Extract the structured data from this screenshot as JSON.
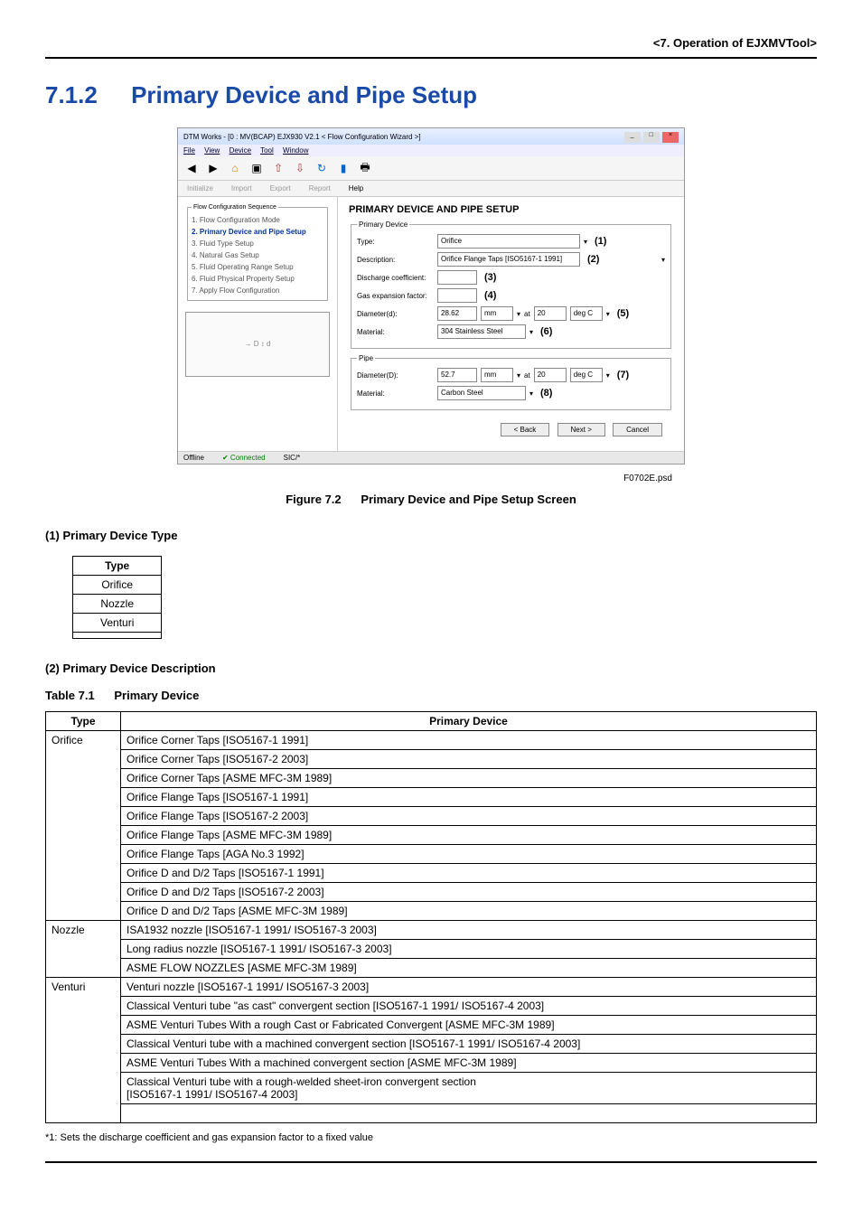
{
  "breadcrumb": "<7.  Operation of EJXMVTool>",
  "heading": {
    "num": "7.1.2",
    "title": "Primary Device and Pipe Setup"
  },
  "screenshot": {
    "titlebar": "DTM Works - [0 : MV(BCAP) EJX930 V2.1 < Flow Configuration Wizard >]",
    "menus": [
      "File",
      "View",
      "Device",
      "Tool",
      "Window"
    ],
    "subbar": [
      "Initialize",
      "Import",
      "Export",
      "Report",
      "Help"
    ],
    "main_title": "PRIMARY DEVICE AND PIPE SETUP",
    "sidebar_legend": "Flow Configuration Sequence",
    "steps": [
      "1. Flow Configuration Mode",
      "2. Primary Device and Pipe Setup",
      "3. Fluid Type Setup",
      "4. Natural Gas Setup",
      "5. Fluid Operating Range Setup",
      "6. Fluid Physical Property Setup",
      "7. Apply Flow Configuration"
    ],
    "primary_legend": "Primary Device",
    "pipe_legend": "Pipe",
    "fields": {
      "type_label": "Type:",
      "type_value": "Orifice",
      "desc_label": "Description:",
      "desc_value": "Orifice Flange Taps [ISO5167-1 1991]",
      "disc_label": "Discharge coefficient:",
      "gas_label": "Gas expansion factor:",
      "diam_d_label": "Diameter(d):",
      "diam_d_val": "28.62",
      "unit_mm": "mm",
      "at": "at",
      "ref_temp": "20",
      "degc": "deg C",
      "mat_label": "Material:",
      "mat1_value": "304 Stainless Steel",
      "diam_D_label": "Diameter(D):",
      "diam_D_val": "52.7",
      "mat2_value": "Carbon Steel"
    },
    "callouts": [
      "(1)",
      "(2)",
      "(3)",
      "(4)",
      "(5)",
      "(6)",
      "(7)",
      "(8)"
    ],
    "buttons": {
      "back": "< Back",
      "next": "Next >",
      "cancel": "Cancel"
    },
    "status": {
      "offline": "Offline",
      "connected": "Connected",
      "sic": "SIC/*"
    }
  },
  "figref": "F0702E.psd",
  "figcaption": {
    "num": "Figure 7.2",
    "title": "Primary Device and Pipe Setup Screen"
  },
  "section1": "(1)   Primary Device Type",
  "type_table": {
    "header": "Type",
    "rows": [
      "Orifice",
      "Nozzle",
      "Venturi",
      ""
    ]
  },
  "section2": "(2)   Primary Device Description",
  "table_label": {
    "num": "Table 7.1",
    "title": "Primary Device"
  },
  "device_table": {
    "headers": [
      "Type",
      "Primary Device"
    ],
    "groups": [
      {
        "type": "Orifice",
        "rows": [
          "Orifice Corner Taps [ISO5167-1 1991]",
          "Orifice Corner Taps [ISO5167-2 2003]",
          "Orifice Corner Taps [ASME MFC-3M 1989]",
          "Orifice Flange Taps [ISO5167-1 1991]",
          "Orifice Flange Taps [ISO5167-2 2003]",
          "Orifice Flange Taps [ASME MFC-3M 1989]",
          "Orifice Flange Taps [AGA No.3 1992]",
          "Orifice D and D/2 Taps [ISO5167-1 1991]",
          "Orifice D and D/2 Taps [ISO5167-2 2003]",
          "Orifice D and D/2 Taps [ASME MFC-3M 1989]"
        ]
      },
      {
        "type": "Nozzle",
        "rows": [
          "ISA1932 nozzle [ISO5167-1 1991/ ISO5167-3 2003]",
          "Long radius nozzle [ISO5167-1 1991/ ISO5167-3 2003]",
          "ASME FLOW NOZZLES [ASME MFC-3M 1989]"
        ]
      },
      {
        "type": "Venturi",
        "rows": [
          "Venturi nozzle [ISO5167-1 1991/ ISO5167-3 2003]",
          "Classical Venturi tube \"as cast\" convergent section [ISO5167-1 1991/ ISO5167-4 2003]",
          "ASME Venturi Tubes With a rough Cast or Fabricated Convergent [ASME MFC-3M 1989]",
          "Classical Venturi tube with a machined convergent section [ISO5167-1 1991/ ISO5167-4 2003]",
          "ASME Venturi Tubes With a machined convergent section [ASME MFC-3M 1989]",
          "Classical Venturi tube with a rough-welded sheet-iron convergent section\n[ISO5167-1 1991/ ISO5167-4 2003]",
          ""
        ]
      }
    ]
  },
  "footnote": "*1:  Sets the discharge coefficient and gas expansion factor to a fixed value"
}
